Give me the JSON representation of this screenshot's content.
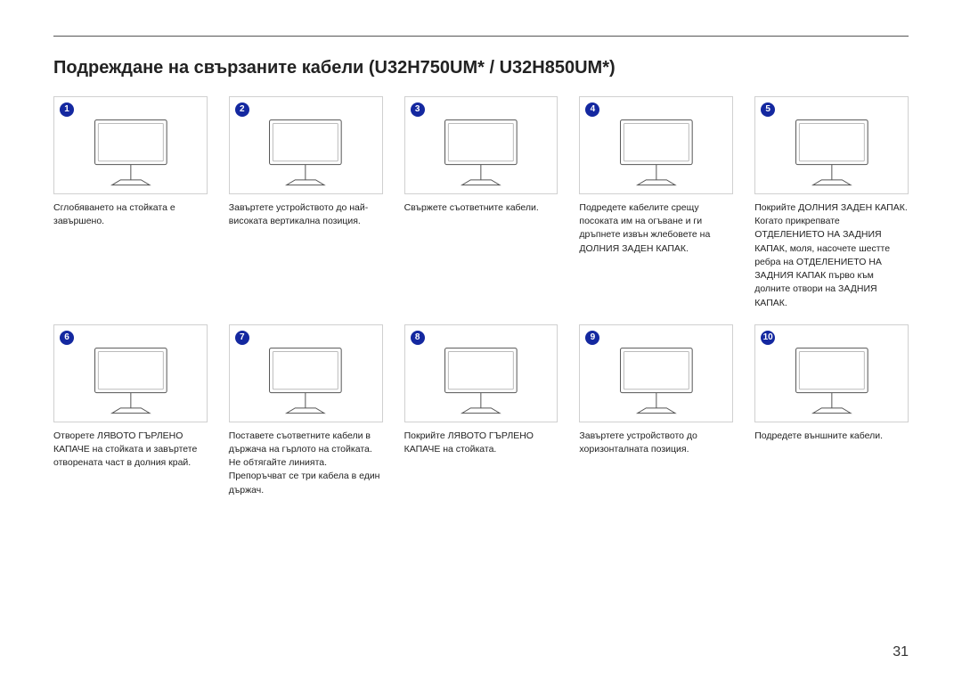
{
  "title": "Подреждане на свързаните кабели (U32H750UM* / U32H850UM*)",
  "page_number": "31",
  "steps": [
    {
      "n": "1",
      "caption": "Сглобяването на стойката е завършено."
    },
    {
      "n": "2",
      "caption": "Завъртете устройството до най-високата вертикална позиция."
    },
    {
      "n": "3",
      "caption": "Свържете съответните кабели."
    },
    {
      "n": "4",
      "caption": "Подредете кабелите срещу посоката им на огъване и ги дръпнете извън жлебовете на ДОЛНИЯ ЗАДЕН КАПАК."
    },
    {
      "n": "5",
      "caption": "Покрийте ДОЛНИЯ ЗАДЕН КАПАК.\nКогато прикрепвате ОТДЕЛЕНИЕТО НА ЗАДНИЯ КАПАК, моля, насочете шестте ребра на ОТДЕЛЕНИЕТО НА ЗАДНИЯ КАПАК първо към долните отвори на ЗАДНИЯ КАПАК."
    },
    {
      "n": "6",
      "caption": "Отворете ЛЯВОТО ГЪРЛЕНО КАПАЧЕ на стойката и завъртете отворената част в долния край."
    },
    {
      "n": "7",
      "caption": "Поставете съответните кабели в държача на гърлото на стойката. Не обтягайте линията. Препоръчват се три кабела в един държач."
    },
    {
      "n": "8",
      "caption": "Покрийте ЛЯВОТО ГЪРЛЕНО КАПАЧЕ на стойката."
    },
    {
      "n": "9",
      "caption": "Завъртете устройството до хоризонталната позиция."
    },
    {
      "n": "10",
      "caption": "Подредете външните кабели."
    }
  ]
}
